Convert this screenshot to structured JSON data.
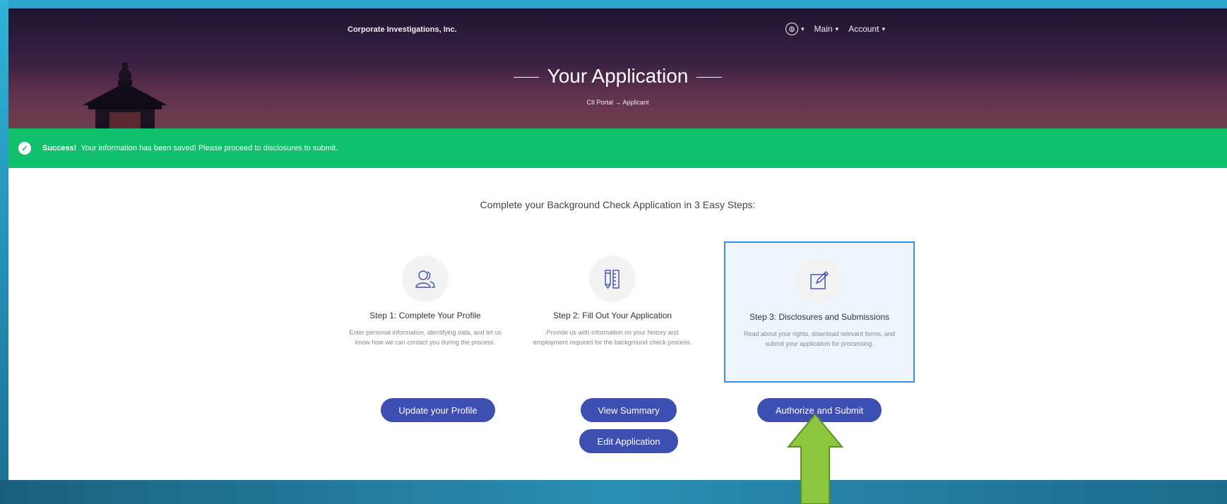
{
  "header": {
    "brand": "Corporate Investigations, Inc.",
    "nav": [
      {
        "label": "Main"
      },
      {
        "label": "Account"
      }
    ],
    "title": "Your Application",
    "breadcrumb": "CII Portal → Applicant"
  },
  "alert": {
    "strong": "Success!",
    "message": "Your information has been saved! Please proceed to disclosures to submit."
  },
  "main": {
    "intro": "Complete your Background Check Application in 3 Easy Steps:",
    "steps": [
      {
        "title": "Step 1: Complete Your Profile",
        "desc": "Enter personal information, identifying data, and let us know how we can contact you during the process.",
        "icon": "users-icon"
      },
      {
        "title": "Step 2: Fill Out Your Application",
        "desc": "Provide us with information on your history and employment required for the background check process.",
        "icon": "ruler-pencil-icon"
      },
      {
        "title": "Step 3: Disclosures and Submissions",
        "desc": "Read about your rights, download relevant forms, and submit your application for processing.",
        "icon": "edit-icon"
      }
    ],
    "buttons": {
      "update_profile": "Update your Profile",
      "view_summary": "View Summary",
      "edit_application": "Edit Application",
      "authorize_submit": "Authorize and Submit"
    }
  },
  "colors": {
    "button": "#3d4fb0",
    "success": "#10c06c",
    "active_border": "#3b8fe0",
    "arrow": "#8dc63f"
  }
}
